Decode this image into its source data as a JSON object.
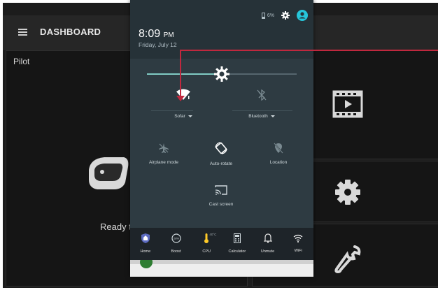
{
  "app": {
    "title": "DASHBOARD",
    "pilot_label": "Pilot",
    "ready_text": "Ready t"
  },
  "status_bar": {
    "battery": "6%"
  },
  "notification_shade": {
    "time": "8:09",
    "ampm": "PM",
    "date": "Friday, July 12",
    "brightness_level": 0.5,
    "tiles": [
      {
        "label": "Sofar",
        "has_dropdown": true
      },
      {
        "label": "Bluetooth",
        "has_dropdown": true
      },
      {
        "label": "Airplane mode"
      },
      {
        "label": "Auto-rotate"
      },
      {
        "label": "Location"
      },
      {
        "label": "Cast screen"
      }
    ]
  },
  "bottom_strip": {
    "items": [
      {
        "label": "Home"
      },
      {
        "label": "Boost",
        "icon_text": "28%"
      },
      {
        "label": "CPU",
        "sub": "40°C"
      },
      {
        "label": "Calculator"
      },
      {
        "label": "Unmute"
      },
      {
        "label": "WiFi"
      }
    ]
  },
  "colors": {
    "shade_bg": "#263238",
    "qs_bg": "#2e3b42",
    "accent": "#80cbc4",
    "annotation": "#c0283e",
    "avatar": "#26c6da"
  }
}
